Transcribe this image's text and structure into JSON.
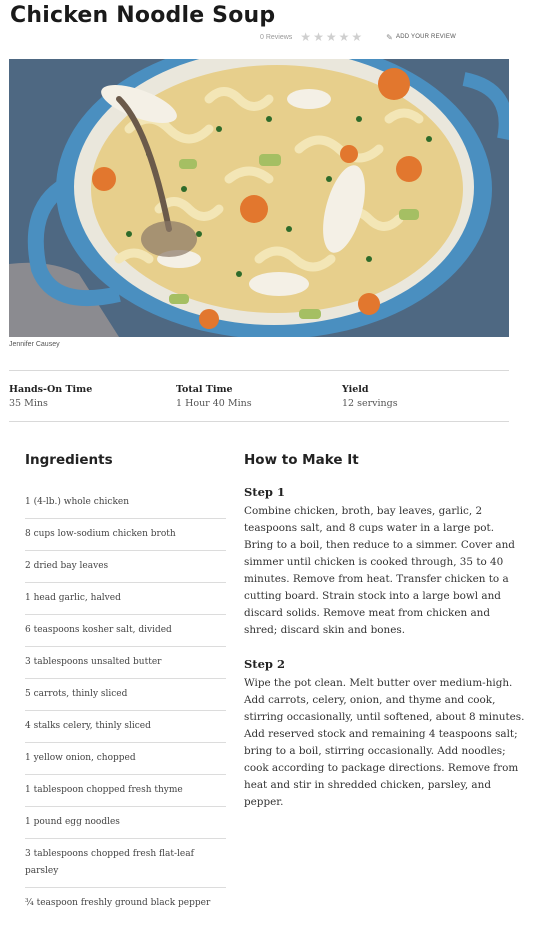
{
  "recipe": {
    "title": "Chicken Noodle Soup",
    "reviews_count": "0 Reviews",
    "rating_stars": 5,
    "add_review": "ADD YOUR REVIEW",
    "photo_credit": "Jennifer Causey",
    "colors": {
      "star": "#cfcfcf",
      "pot": "#4a8fc0",
      "broth": "#e8d39a",
      "carrot": "#e2772e"
    }
  },
  "times": [
    {
      "label": "Hands-On Time",
      "value": "35 Mins"
    },
    {
      "label": "Total Time",
      "value": "1 Hour 40 Mins"
    },
    {
      "label": "Yield",
      "value": "12 servings"
    }
  ],
  "ingredients": {
    "heading": "Ingredients",
    "items": [
      "1 (4-lb.) whole chicken",
      "8 cups low-sodium chicken broth",
      "2 dried bay leaves",
      "1 head garlic, halved",
      "6 teaspoons kosher salt, divided",
      "3 tablespoons unsalted butter",
      "5 carrots, thinly sliced",
      "4 stalks celery, thinly sliced",
      "1 yellow onion, chopped",
      "1 tablespoon chopped fresh thyme",
      "1 pound egg noodles",
      "3 tablespoons chopped fresh flat-leaf parsley",
      "¾ teaspoon freshly ground black pepper"
    ]
  },
  "directions": {
    "heading": "How to Make It",
    "steps": [
      {
        "title": "Step 1",
        "text": "Combine chicken, broth, bay leaves, garlic, 2 teaspoons salt, and 8 cups water in a large pot. Bring to a boil, then reduce to a simmer. Cover and simmer until chicken is cooked through, 35 to 40 minutes. Remove from heat. Transfer chicken to a cutting board. Strain stock into a large bowl and discard solids. Remove meat from chicken and shred; discard skin and bones."
      },
      {
        "title": "Step 2",
        "text": "Wipe the pot clean. Melt butter over medium-high. Add carrots, celery, onion, and thyme and cook, stirring occasionally, until softened, about 8 minutes. Add reserved stock and remaining 4 teaspoons salt; bring to a boil, stirring occasionally. Add noodles; cook according to package directions. Remove from heat and stir in shredded chicken, parsley, and pepper."
      }
    ]
  }
}
